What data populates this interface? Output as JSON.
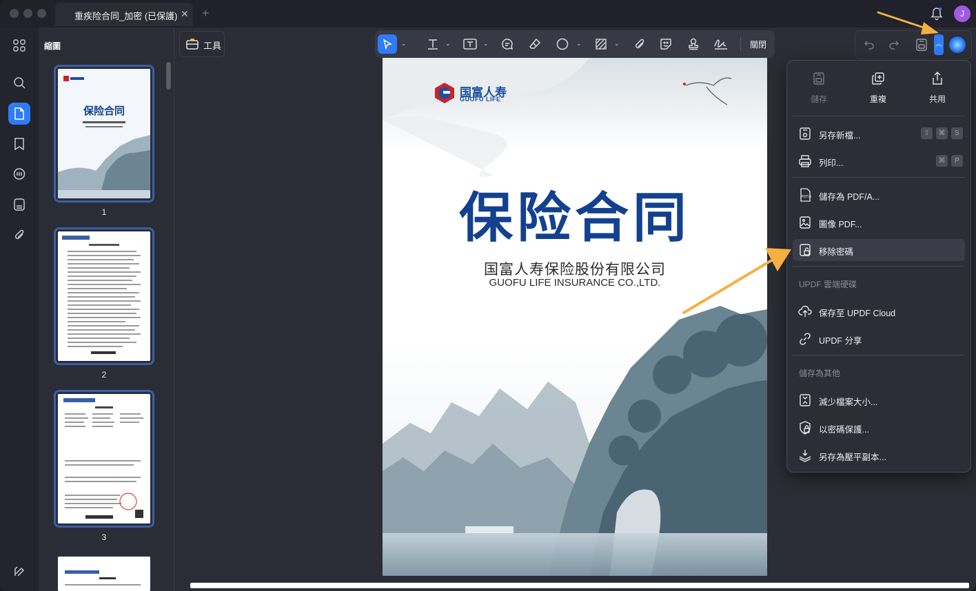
{
  "window": {
    "tab_title": "重疾险合同_加密 (已保護)",
    "avatar_letter": "J"
  },
  "sidebar": {
    "panel_title": "縮圖",
    "pages": [
      "1",
      "2",
      "3"
    ]
  },
  "toolbar": {
    "tools_label": "工具",
    "close_label": "關閉"
  },
  "document": {
    "logo_cn": "国富人寿",
    "logo_en": "GUOFU LIFE",
    "title": "保险合同",
    "company_cn": "国富人寿保险股份有限公司",
    "company_en": "GUOFU LIFE INSURANCE CO.,LTD."
  },
  "menu": {
    "top": [
      {
        "label": "儲存",
        "icon": "save-icon",
        "disabled": true
      },
      {
        "label": "重複",
        "icon": "duplicate-icon",
        "disabled": false
      },
      {
        "label": "共用",
        "icon": "share-icon",
        "disabled": false
      }
    ],
    "save_as_new": {
      "label": "另存新檔...",
      "shortcut": [
        "⇧",
        "⌘",
        "S"
      ]
    },
    "print": {
      "label": "列印...",
      "shortcut": [
        "⌘",
        "P"
      ]
    },
    "save_pdfa": "儲存為 PDF/A...",
    "image_pdf": "圖像 PDF...",
    "remove_password": "移除密碼",
    "cloud_header": "UPDF 雲端硬碟",
    "save_cloud": "保存至 UPDF Cloud",
    "updf_share": "UPDF 分享",
    "other_header": "儲存為其他",
    "reduce_size": "減少檔案大小...",
    "protect_password": "以密碼保護...",
    "flatten_copy": "另存為壓平副本..."
  },
  "colors": {
    "accent": "#2f7cf6",
    "brand_blue": "#13418f",
    "annotation_arrow": "#f5b040"
  }
}
